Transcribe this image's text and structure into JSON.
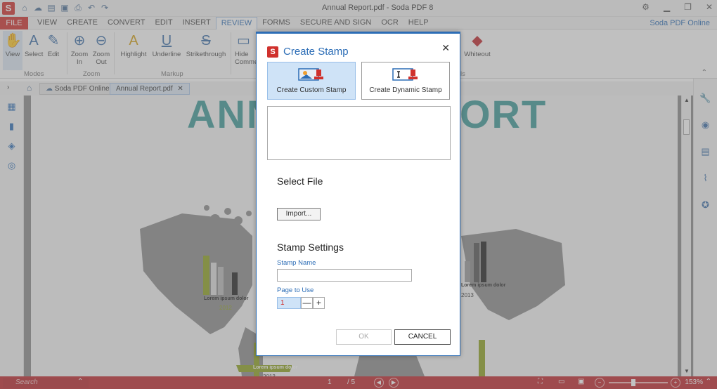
{
  "app": {
    "title": "Annual Report.pdf   -   Soda PDF 8",
    "logo": "S",
    "online_link": "Soda PDF Online"
  },
  "menu": {
    "file": "FILE",
    "items": [
      "VIEW",
      "CREATE",
      "CONVERT",
      "EDIT",
      "INSERT",
      "REVIEW",
      "FORMS",
      "SECURE AND SIGN",
      "OCR",
      "HELP"
    ],
    "active": "REVIEW"
  },
  "ribbon": {
    "view": "View",
    "select": "Select",
    "edit": "Edit",
    "zoom_in": "Zoom In",
    "zoom_out": "Zoom Out",
    "highlight": "Highlight",
    "underline": "Underline",
    "strikethrough": "Strikethrough",
    "hide_comments": "Hide Comme",
    "whiteout": "Whiteout",
    "group_modes": "Modes",
    "group_zoom": "Zoom",
    "group_markup": "Markup",
    "group_ls": "ls"
  },
  "tabs": {
    "online": "Soda PDF Online",
    "doc": "Annual Report.pdf"
  },
  "document": {
    "heading_left": "ANN",
    "heading_right": "ORT",
    "chart_label_1": "Lorem ipsum dolor",
    "year_1": "2012",
    "chart_label_2": "Lorem ipsum dolor",
    "year_2": "2013",
    "chart_label_3": "Lorem ipsum dolor",
    "year_3": "2013"
  },
  "dialog": {
    "title": "Create Stamp",
    "custom_stamp": "Create Custom Stamp",
    "dynamic_stamp": "Create Dynamic Stamp",
    "select_file": "Select File",
    "import": "Import...",
    "stamp_settings": "Stamp Settings",
    "stamp_name_label": "Stamp Name",
    "stamp_name_value": "",
    "page_to_use_label": "Page to Use",
    "page_to_use_value": "1",
    "minus": "—",
    "plus": "+",
    "ok": "OK",
    "cancel": "CANCEL"
  },
  "status": {
    "search_placeholder": "Search",
    "page_current": "1",
    "page_total": "/ 5",
    "zoom": "153%"
  },
  "colors": {
    "brand_red": "#d0312d",
    "accent_blue": "#2c6db6",
    "teal_heading": "#3d9a97",
    "olive_bar": "#8fa21f"
  }
}
